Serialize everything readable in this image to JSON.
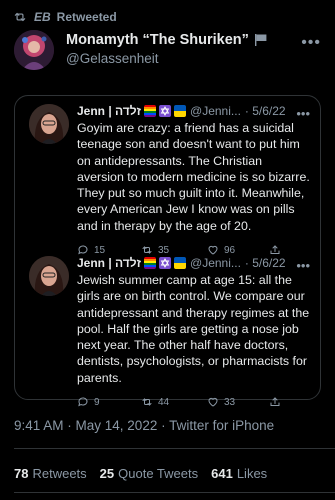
{
  "retweet": {
    "label": "Retweeted",
    "user": "EB"
  },
  "author": {
    "display_name": "Monamyth “The Shuriken”",
    "handle": "@Gelassenheit"
  },
  "quoted_tweets": [
    {
      "name": "Jenn | זלדה",
      "handle": "@Jenni...",
      "date": "· 5/6/22",
      "text": "Goyim are crazy: a friend has a suicidal teenage son and doesn't want to put him on antidepressants. The Christian aversion to modern medicine is so bizarre. They put so much guilt into it. Meanwhile, every American Jew I know was on pills and in therapy by the age of 20.",
      "replies": "15",
      "retweets": "35",
      "likes": "96"
    },
    {
      "name": "Jenn | זלדה",
      "handle": "@Jenni...",
      "date": "· 5/6/22",
      "text": "Jewish summer camp at age 15: all the girls are on birth control. We compare our antidepressant and therapy regimes at the pool. Half the girls are getting a nose job next year. The other half have doctors, dentists, psychologists, or pharmacists for parents.",
      "replies": "9",
      "retweets": "44",
      "likes": "33"
    }
  ],
  "timestamp": "9:41 AM · May 14, 2022 · Twitter for iPhone",
  "stats": [
    {
      "num": "78",
      "label": "Retweets"
    },
    {
      "num": "25",
      "label": "Quote Tweets"
    },
    {
      "num": "641",
      "label": "Likes"
    }
  ],
  "icons": {
    "retweet": "retweet-icon",
    "more": "more-horizontal-icon",
    "reply": "reply-icon",
    "like": "heart-icon",
    "share": "share-icon"
  },
  "colors": {
    "background": "#000000",
    "text": "#e7e9ea",
    "muted": "#8b98a5",
    "border": "#2f3336"
  }
}
